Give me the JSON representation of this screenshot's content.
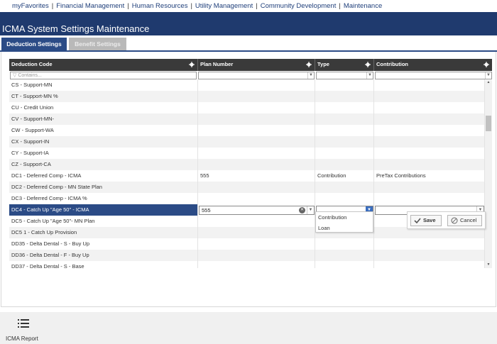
{
  "topnav": {
    "items": [
      "myFavorites",
      "Financial Management",
      "Human Resources",
      "Utility Management",
      "Community Development",
      "Maintenance"
    ]
  },
  "header": {
    "title": "ICMA System Settings Maintenance"
  },
  "tabs": {
    "active": "Deduction Settings",
    "inactive": "Benefit Settings"
  },
  "grid": {
    "columns": [
      "Deduction Code",
      "Plan Number",
      "Type",
      "Contribution"
    ],
    "filter_placeholder": "Contains...",
    "rows": [
      [
        "CS - Support-MN",
        "",
        "",
        ""
      ],
      [
        "CT - Support-MN %",
        "",
        "",
        ""
      ],
      [
        "CU - Credit Union",
        "",
        "",
        ""
      ],
      [
        "CV - Support-MN-",
        "",
        "",
        ""
      ],
      [
        "CW - Support-WA",
        "",
        "",
        ""
      ],
      [
        "CX - Support-IN",
        "",
        "",
        ""
      ],
      [
        "CY - Support-IA",
        "",
        "",
        ""
      ],
      [
        "CZ - Support-CA",
        "",
        "",
        ""
      ],
      [
        "DC1 - Deferred Comp - ICMA",
        "555",
        "Contribution",
        "PreTax Contributions"
      ],
      [
        "DC2 - Deferred Comp - MN State Plan",
        "",
        "",
        ""
      ],
      [
        "DC3 - Deferred Comp - ICMA %",
        "",
        "",
        ""
      ],
      [
        "DC4 - Catch Up \"Age 50\" - ICMA",
        "555",
        "",
        ""
      ],
      [
        "DC5 - Catch Up \"Age 50\"- MN Plan",
        "",
        "",
        ""
      ],
      [
        "DC5 1 - Catch Up Provision",
        "",
        "",
        ""
      ],
      [
        "DD35 - Delta Dental - S - Buy Up",
        "",
        "",
        ""
      ],
      [
        "DD36 - Delta Dental - F - Buy Up",
        "",
        "",
        ""
      ],
      [
        "DD37 - Delta Dental - S - Base",
        "",
        "",
        ""
      ]
    ],
    "edit_row_index": 11,
    "type_options": [
      "Contribution",
      "Loan"
    ]
  },
  "actions": {
    "save": "Save",
    "cancel": "Cancel"
  },
  "footer": {
    "report_label": "ICMA Report"
  },
  "colors": {
    "header": "#1f3a6e",
    "tab_active": "#2b4b86",
    "selected_row": "#2b4b86"
  }
}
